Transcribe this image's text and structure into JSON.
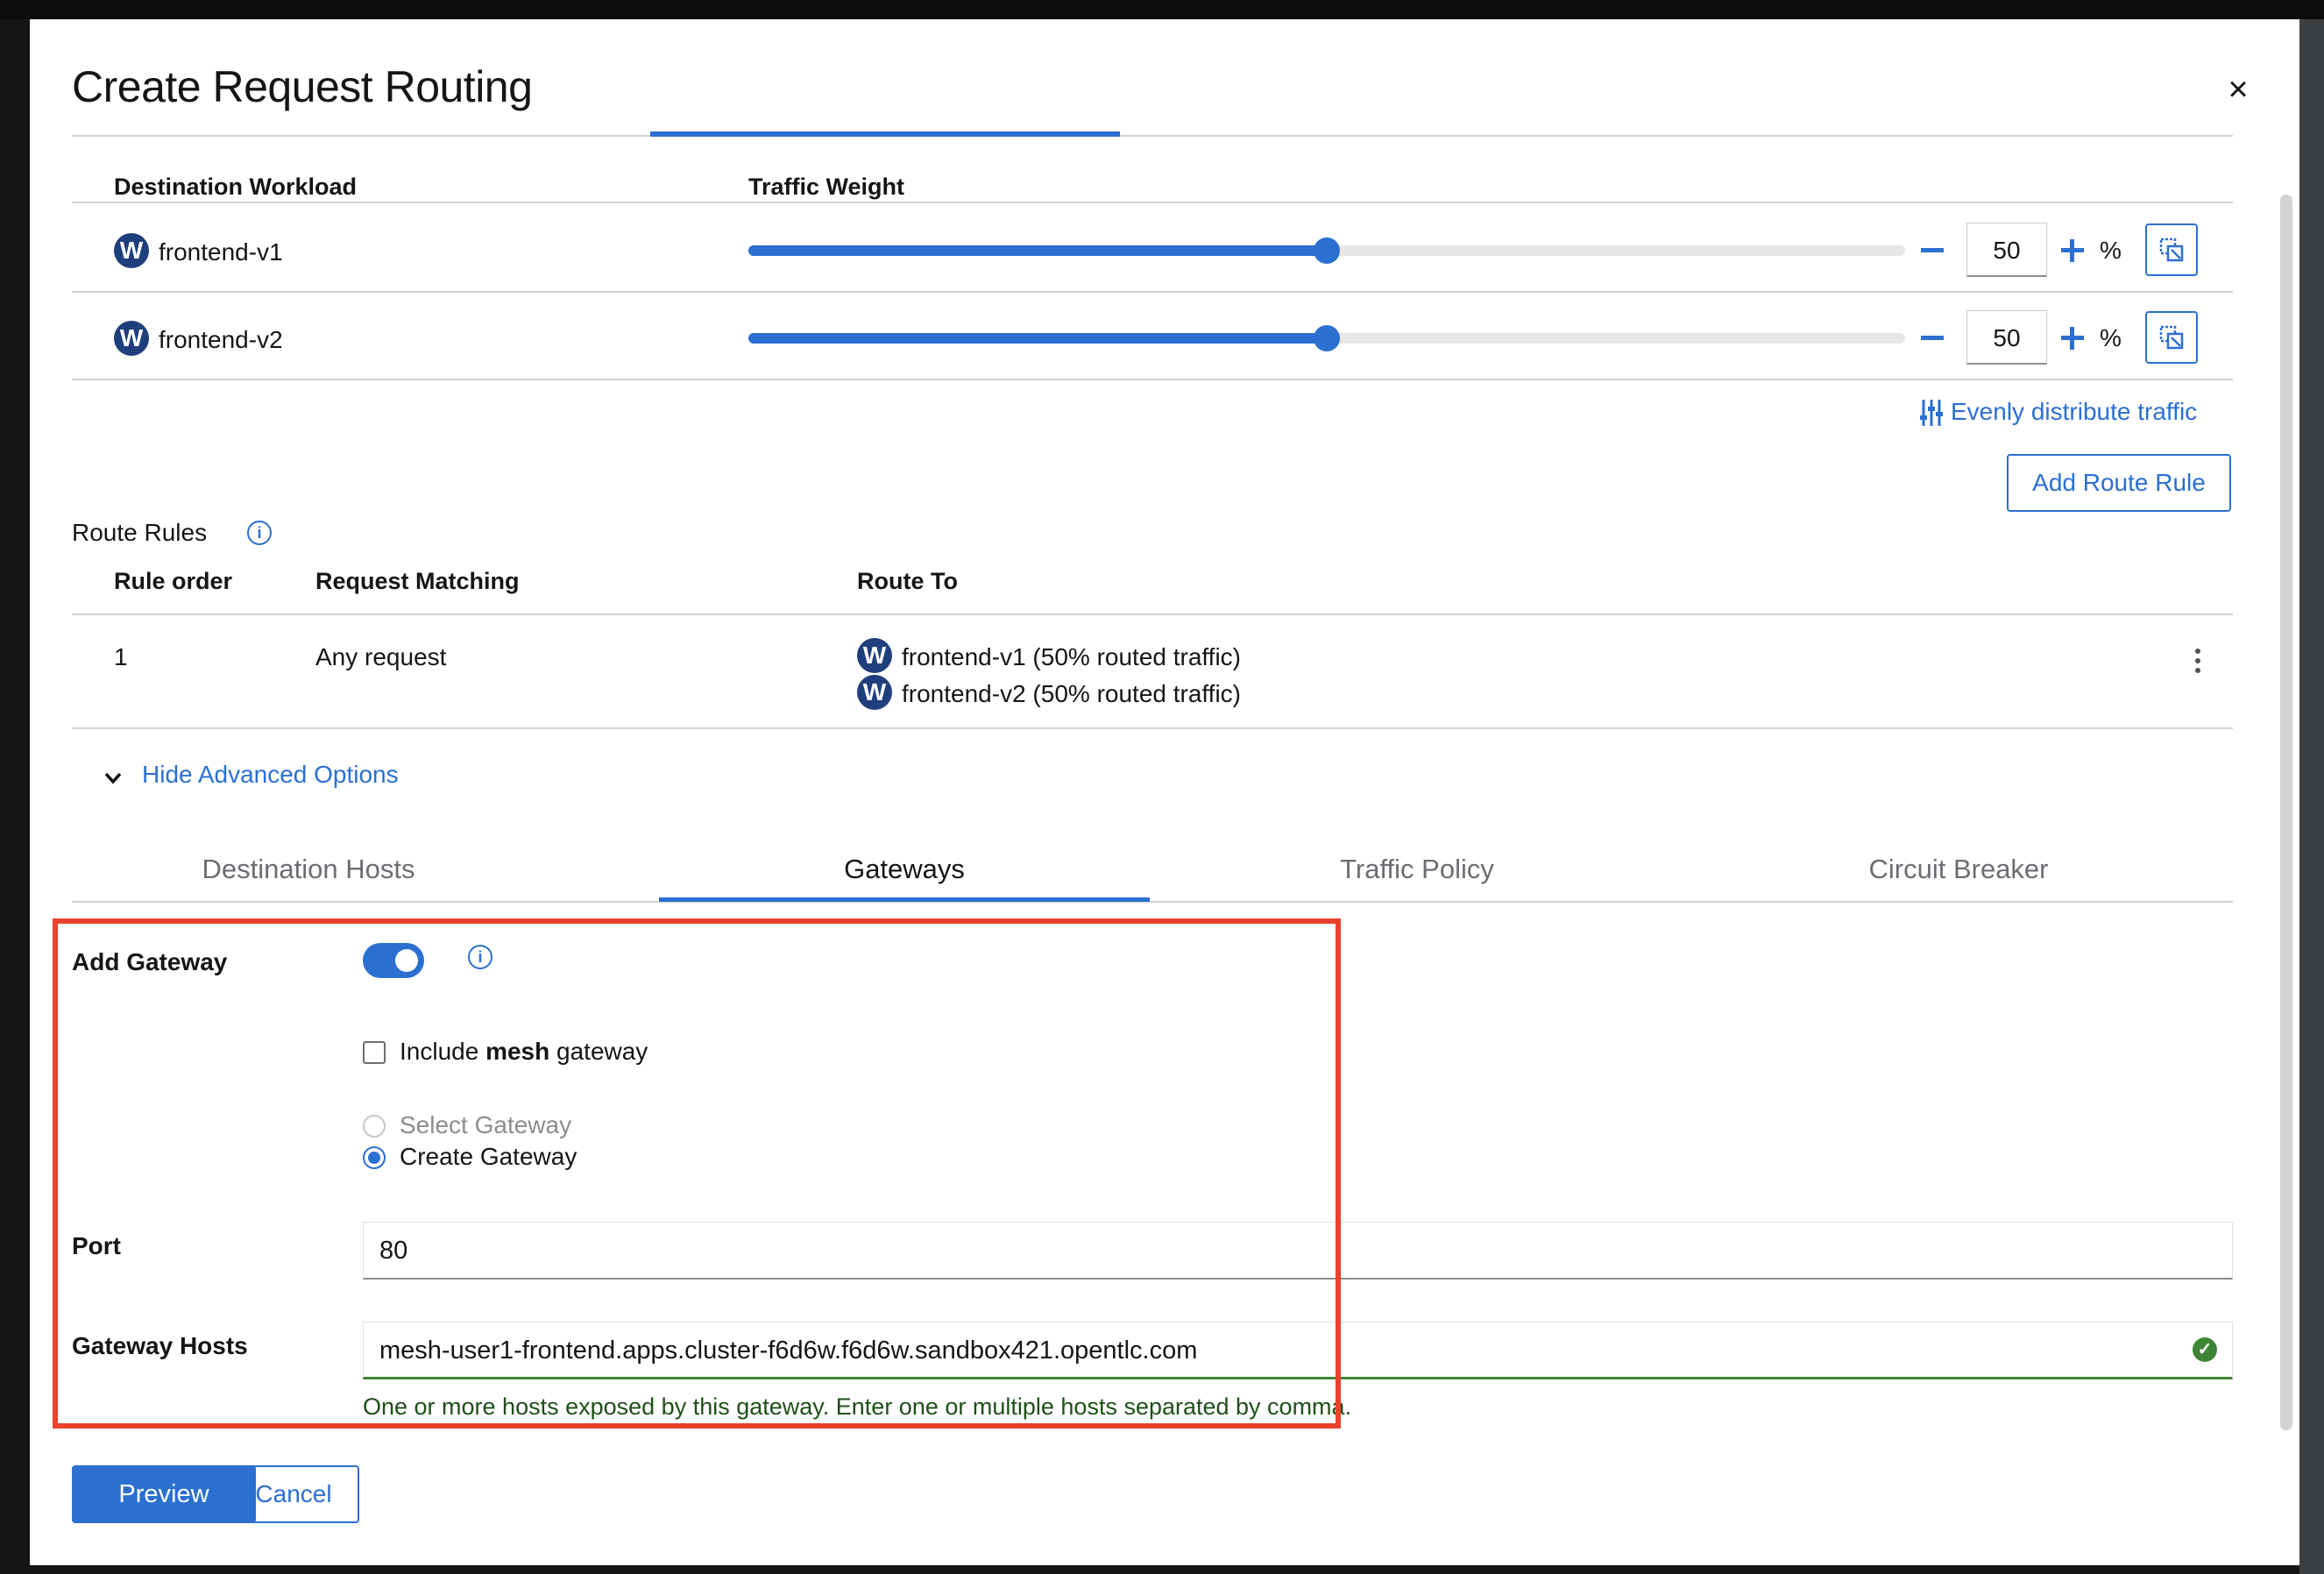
{
  "dialog": {
    "title": "Create Request Routing",
    "close_icon": "close-icon"
  },
  "workloads": {
    "headers": {
      "destination": "Destination Workload",
      "weight": "Traffic Weight"
    },
    "rows": [
      {
        "badge": "W",
        "name": "frontend-v1",
        "weight": "50",
        "unit": "%",
        "weight_fraction": 0.5
      },
      {
        "badge": "W",
        "name": "frontend-v2",
        "weight": "50",
        "unit": "%",
        "weight_fraction": 0.5
      }
    ],
    "evenly_label": "Evenly distribute traffic",
    "add_route_rule_label": "Add Route Rule"
  },
  "route_rules": {
    "title": "Route Rules",
    "headers": {
      "order": "Rule order",
      "matching": "Request Matching",
      "route_to": "Route To"
    },
    "rows": [
      {
        "order": "1",
        "matching": "Any request",
        "routes": [
          {
            "badge": "W",
            "text": "frontend-v1 (50% routed traffic)"
          },
          {
            "badge": "W",
            "text": "frontend-v2 (50% routed traffic)"
          }
        ]
      }
    ]
  },
  "advanced": {
    "toggle_label": "Hide Advanced Options",
    "tabs": [
      {
        "label": "Destination Hosts",
        "active": false
      },
      {
        "label": "Gateways",
        "active": true
      },
      {
        "label": "Traffic Policy",
        "active": false
      },
      {
        "label": "Circuit Breaker",
        "active": false
      }
    ]
  },
  "gateways_form": {
    "add_gateway_label": "Add Gateway",
    "add_gateway_on": true,
    "include_mesh_prefix": "Include ",
    "include_mesh_bold": "mesh",
    "include_mesh_suffix": " gateway",
    "include_mesh_checked": false,
    "select_gateway_label": "Select Gateway",
    "create_gateway_label": "Create Gateway",
    "selected_option": "Create Gateway",
    "port_label": "Port",
    "port_value": "80",
    "gateway_hosts_label": "Gateway Hosts",
    "gateway_hosts_value": "mesh-user1-frontend.apps.cluster-f6d6w.f6d6w.sandbox421.opentlc.com",
    "gateway_hosts_helper": "One or more hosts exposed by this gateway. Enter one or multiple hosts separated by comma."
  },
  "footer": {
    "preview_label": "Preview",
    "cancel_label": "Cancel"
  },
  "colors": {
    "accent": "#2b6fd1",
    "badge": "#1f3e7c",
    "success": "#3e8635",
    "highlight": "#e8412c"
  }
}
